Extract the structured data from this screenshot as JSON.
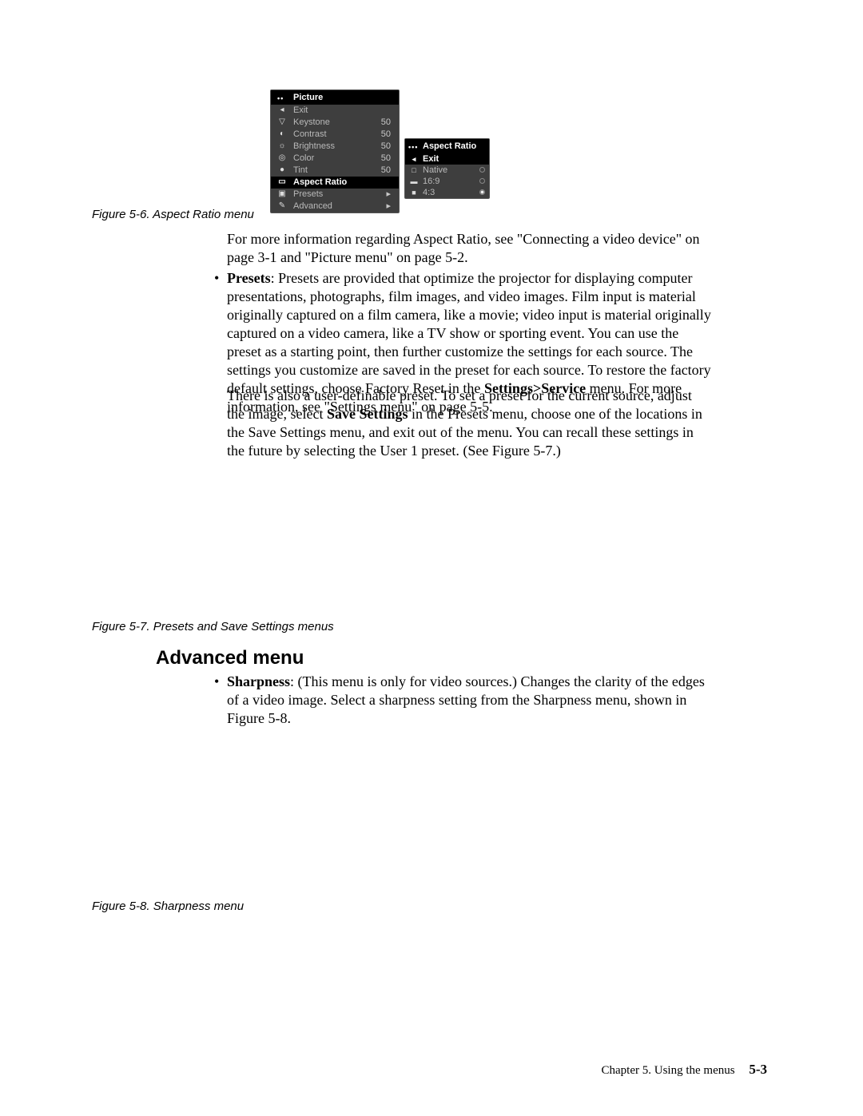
{
  "figure56": {
    "caption": "Figure 5-6. Aspect Ratio menu",
    "picture_menu": {
      "title": "Picture",
      "rows": [
        {
          "icon": "◂",
          "label": "Exit",
          "value": ""
        },
        {
          "icon": "▽",
          "label": "Keystone",
          "value": "50"
        },
        {
          "icon": "◐",
          "label": "Contrast",
          "value": "50"
        },
        {
          "icon": "☼",
          "label": "Brightness",
          "value": "50"
        },
        {
          "icon": "◎",
          "label": "Color",
          "value": "50"
        },
        {
          "icon": "●",
          "label": "Tint",
          "value": "50"
        },
        {
          "icon": "▭",
          "label": "Aspect Ratio",
          "value": "",
          "hl": true
        },
        {
          "icon": "▣",
          "label": "Presets",
          "value": "▸"
        },
        {
          "icon": "✎",
          "label": "Advanced",
          "value": "▸"
        }
      ]
    },
    "aspect_menu": {
      "title": "Aspect Ratio",
      "rows": [
        {
          "icon": "◂",
          "label": "Exit",
          "hl": true
        },
        {
          "icon": "□",
          "label": "Native",
          "checked": false
        },
        {
          "icon": "▬",
          "label": "16:9",
          "checked": false
        },
        {
          "icon": "■",
          "label": "4:3",
          "checked": true
        }
      ]
    }
  },
  "para_aspect_info": "For more information regarding Aspect Ratio, see \"Connecting a video device\" on page 3-1 and \"Picture menu\" on page 5-2.",
  "presets": {
    "label": "Presets",
    "text1": ": Presets are provided that optimize the projector for displaying computer presentations, photographs, film images, and video images. Film input is material originally captured on a film camera, like a movie; video input is material originally captured on a video camera, like a TV show or sporting event. You can use the preset as a starting point, then further customize the settings for each source. The settings you customize are saved in the preset for each source. To restore the factory default settings, choose Factory Reset in the ",
    "bold_menu": "Settings>Service",
    "text1b": " menu. For more information, see \"Settings menu\" on page 5-5.",
    "text2a": "There is also a user-definable preset. To set a preset for the current source, adjust the image, select ",
    "bold_save": "Save Settings",
    "text2b": " in the Presets menu, choose one of the locations in the Save Settings menu, and exit out of the menu. You can recall these settings in the future by selecting the User 1 preset. (See Figure 5-7.)"
  },
  "figure57": {
    "caption": "Figure 5-7. Presets and Save Settings menus"
  },
  "advanced_heading": "Advanced menu",
  "sharpness": {
    "label": "Sharpness",
    "text": ": (This menu is only for video sources.) Changes the clarity of the edges of a video image. Select a sharpness setting from the Sharpness menu, shown in Figure 5-8."
  },
  "figure58": {
    "caption": "Figure 5-8. Sharpness menu"
  },
  "footer": {
    "chapter": "Chapter 5. Using the menus",
    "page": "5-3"
  }
}
